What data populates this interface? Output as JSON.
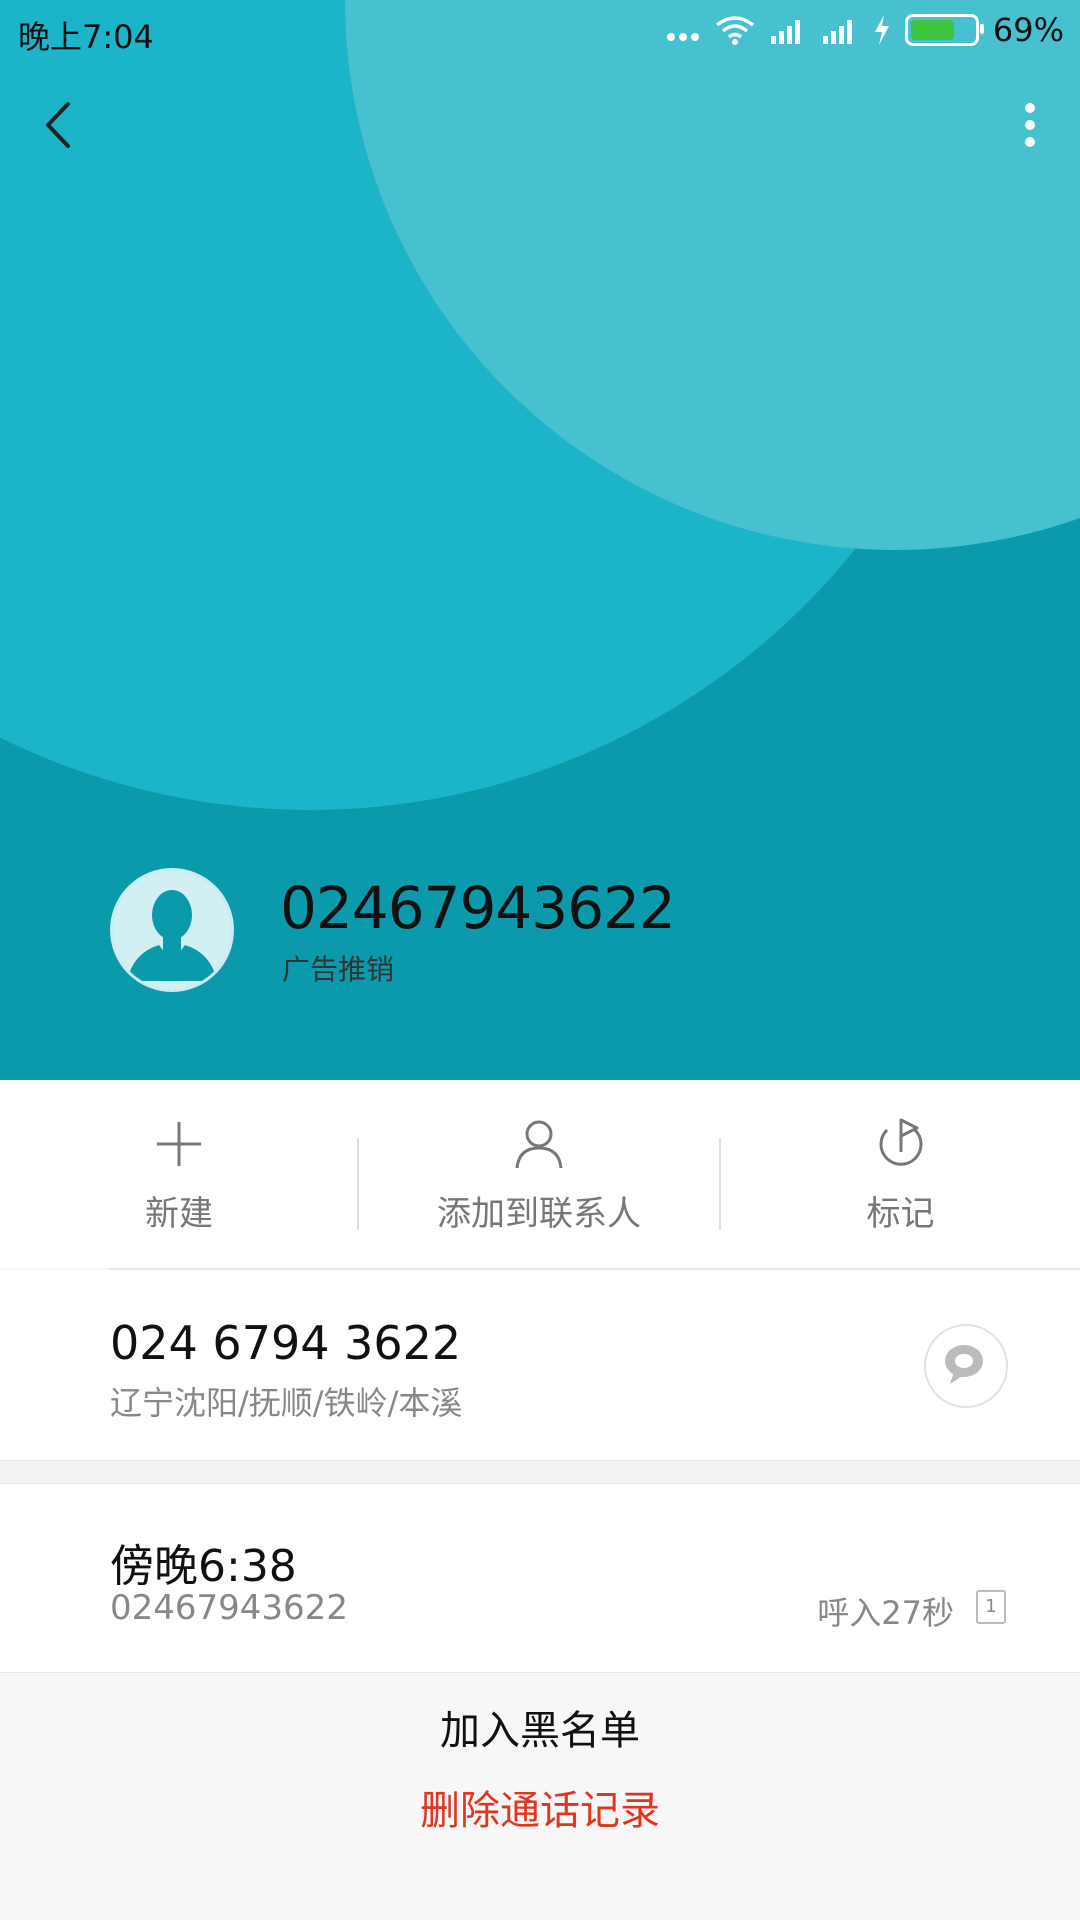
{
  "status_bar": {
    "time": "晚上7:04",
    "battery_text": "69%",
    "battery_level": 0.69
  },
  "contact": {
    "number": "02467943622",
    "tag": "广告推销"
  },
  "actions": [
    {
      "label": "新建",
      "icon": "plus-icon"
    },
    {
      "label": "添加到联系人",
      "icon": "person-icon"
    },
    {
      "label": "标记",
      "icon": "flag-icon"
    }
  ],
  "phone": {
    "formatted": "024 6794 3622",
    "location": "辽宁沈阳/抚顺/铁岭/本溪"
  },
  "call_log": {
    "time": "傍晚6:38",
    "number": "02467943622",
    "duration": "呼入27秒",
    "sim": "1"
  },
  "menu": {
    "blacklist": "加入黑名单",
    "delete": "删除通话记录"
  },
  "colors": {
    "hero_dark": "#0a9aac",
    "hero_mid": "#1cb4c8",
    "hero_light": "#47c0cf",
    "delete_red": "#e0361f"
  }
}
